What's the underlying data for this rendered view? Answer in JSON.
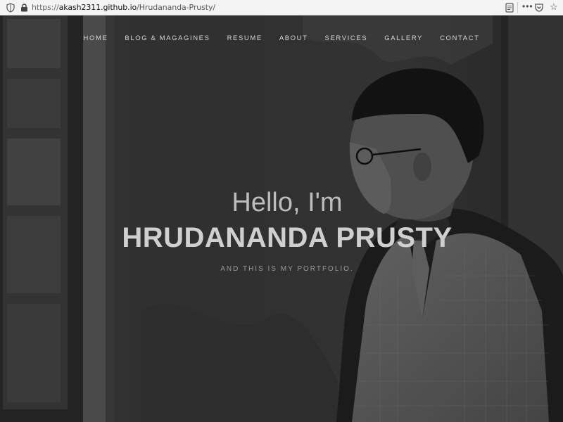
{
  "browser": {
    "url_scheme": "https://",
    "url_host": "akash2311.github.io",
    "url_path": "/Hrudananda-Prusty/",
    "icons": [
      "shield-icon",
      "lock-icon",
      "reader-view-icon",
      "more-menu-icon",
      "pocket-icon",
      "bookmark-star-icon"
    ]
  },
  "nav": {
    "items": [
      {
        "label": "HOME"
      },
      {
        "label": "BLOG & MAGAGINES"
      },
      {
        "label": "RESUME"
      },
      {
        "label": "ABOUT"
      },
      {
        "label": "SERVICES"
      },
      {
        "label": "GALLERY"
      },
      {
        "label": "CONTACT"
      }
    ]
  },
  "hero": {
    "greeting": "Hello, I'm",
    "name": "HRUDANANDA PRUSTY",
    "tagline": "AND THIS IS MY PORTFOLIO."
  }
}
